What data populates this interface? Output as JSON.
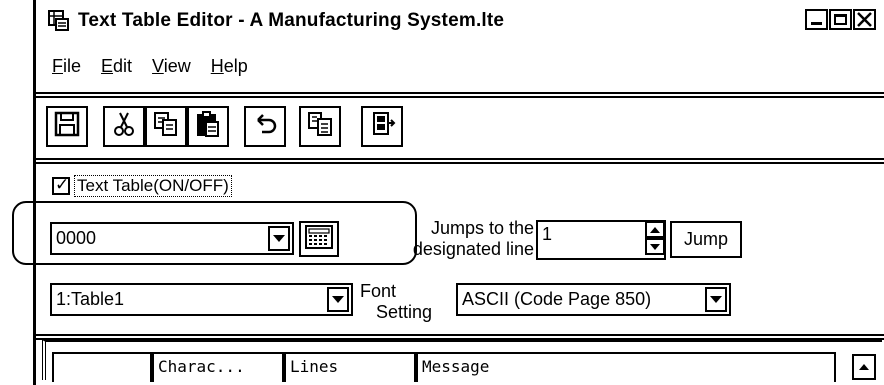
{
  "window": {
    "title": "Text Table Editor - A Manufacturing System.lte"
  },
  "menu": {
    "items": [
      {
        "label": "File",
        "mnemonic": "F",
        "rest": "ile"
      },
      {
        "label": "Edit",
        "mnemonic": "E",
        "rest": "dit"
      },
      {
        "label": "View",
        "mnemonic": "V",
        "rest": "iew"
      },
      {
        "label": "Help",
        "mnemonic": "H",
        "rest": "elp"
      }
    ]
  },
  "toolbar": {
    "buttons": [
      "save-icon",
      "cut-icon",
      "copy-icon",
      "paste-icon",
      "undo-icon",
      "import-icon",
      "exit-icon"
    ]
  },
  "text_table": {
    "checkbox_label": "Text Table(ON/OFF)",
    "checked": true
  },
  "line_select": {
    "value": "0000"
  },
  "jump": {
    "label_line1": "Jumps to the",
    "label_line2": "designated line",
    "value": "1",
    "button": "Jump"
  },
  "table_select": {
    "value": "1:Table1"
  },
  "font": {
    "label_line1": "Font",
    "label_line2": "Setting",
    "value": "ASCII (Code Page 850)"
  },
  "grid": {
    "columns": [
      "",
      "Charac...",
      "Lines",
      "Message"
    ]
  }
}
